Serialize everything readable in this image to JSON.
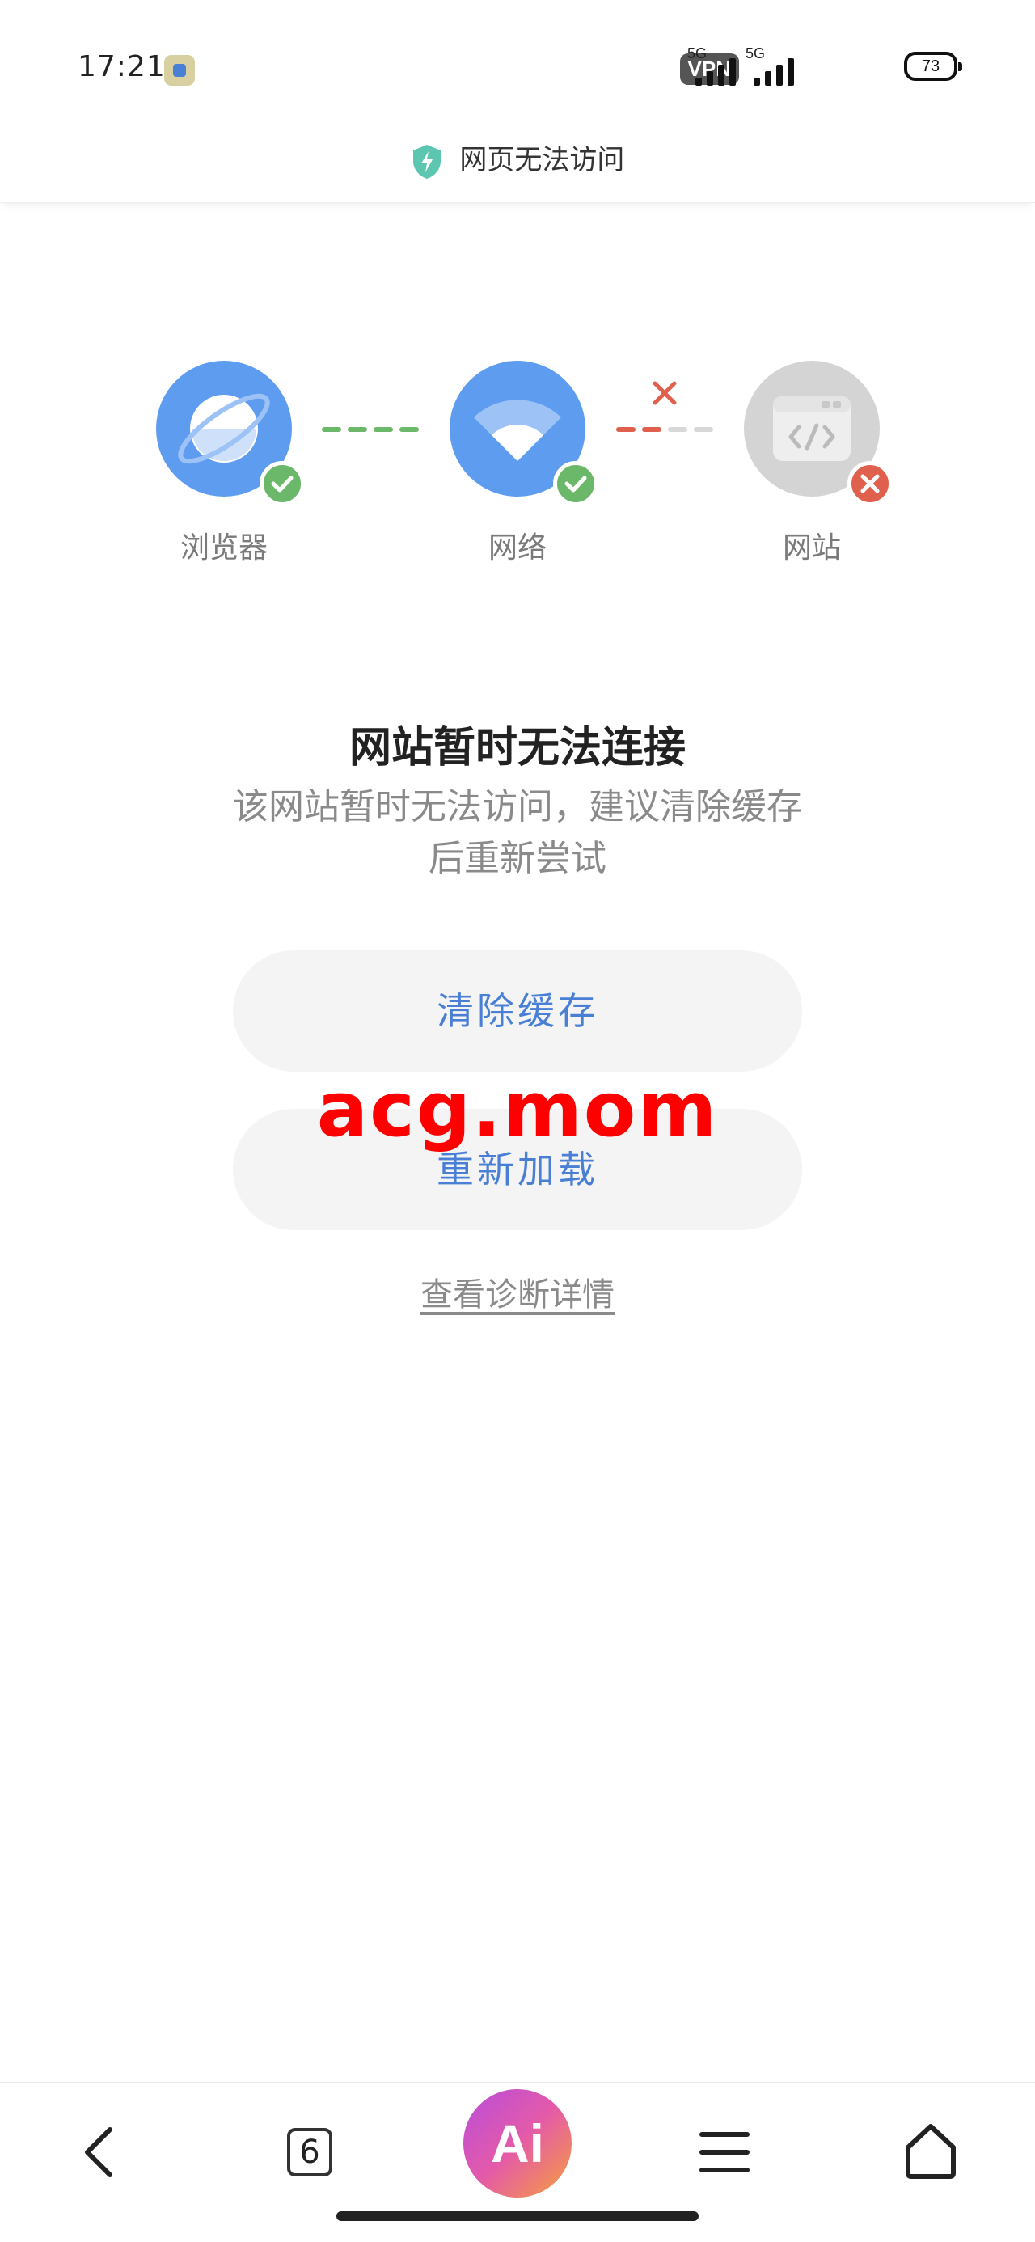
{
  "status_bar": {
    "time": "17:21",
    "vpn_label": "VPN",
    "network_labels": [
      "5G",
      "5G"
    ],
    "battery_level": "73",
    "icons": [
      "app-notification-icon",
      "vpn-icon",
      "signal-icon",
      "signal-icon",
      "battery-icon"
    ]
  },
  "header": {
    "title": "网页无法访问",
    "icon": "shield-bolt-icon",
    "icon_color": "#5cc6b0"
  },
  "diagnosis": {
    "nodes": [
      {
        "label": "浏览器",
        "icon": "planet-icon",
        "status": "ok"
      },
      {
        "label": "网络",
        "icon": "wifi-icon",
        "status": "ok"
      },
      {
        "label": "网站",
        "icon": "code-window-icon",
        "status": "error"
      }
    ],
    "connectors": [
      {
        "status": "ok"
      },
      {
        "status": "error"
      }
    ],
    "colors": {
      "ok": "#6cb86a",
      "error": "#e0604e",
      "active_circle": "#5e9cf0",
      "inactive_circle": "#d4d4d4"
    }
  },
  "message": {
    "title": "网站暂时无法连接",
    "body": "该网站暂时无法访问，建议清除缓存后重新尝试"
  },
  "actions": {
    "clear_cache": "清除缓存",
    "reload": "重新加载",
    "details_link": "查看诊断详情"
  },
  "watermark": "acg.mom",
  "bottom_nav": {
    "tab_count": "6",
    "ai_label": "Ai",
    "items": [
      "back-icon",
      "tabs-icon",
      "ai-assistant-icon",
      "menu-icon",
      "home-icon"
    ]
  }
}
